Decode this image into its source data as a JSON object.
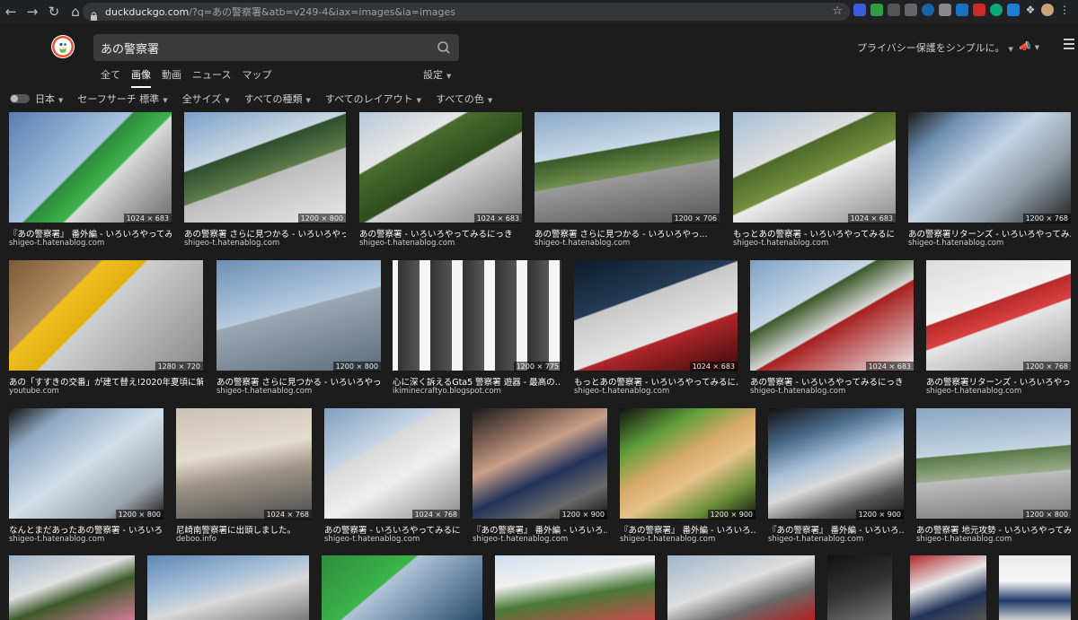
{
  "browser": {
    "url_host": "duckduckgo.com",
    "url_rest": "/?q=あの警察署&atb=v249-4&iax=images&ia=images"
  },
  "search": {
    "query": "あの警察署"
  },
  "tabs": [
    {
      "label": "全て",
      "active": false
    },
    {
      "label": "画像",
      "active": true
    },
    {
      "label": "動画",
      "active": false
    },
    {
      "label": "ニュース",
      "active": false
    },
    {
      "label": "マップ",
      "active": false
    }
  ],
  "settings_label": "設定",
  "privacy_label": "プライバシー保護をシンプルに。",
  "filters": {
    "region": "日本",
    "items": [
      "セーフサーチ 標準",
      "全サイズ",
      "すべての種類",
      "すべてのレイアウト",
      "すべての色"
    ]
  },
  "images": [
    {
      "dims": "1024 × 683",
      "title": "『あの警察署』 番外編 - いろいろやってみ...",
      "source": "shigeo-t.hatenablog.com"
    },
    {
      "dims": "1200 × 800",
      "title": "あの警察署 さらに見つかる - いろいろやっ...",
      "source": "shigeo-t.hatenablog.com"
    },
    {
      "dims": "1024 × 683",
      "title": "あの警察署 - いろいろやってみるにっき",
      "source": "shigeo-t.hatenablog.com"
    },
    {
      "dims": "1200 × 706",
      "title": "あの警察署 さらに見つかる - いろいろやっ...",
      "source": "shigeo-t.hatenablog.com"
    },
    {
      "dims": "1024 × 683",
      "title": "もっとあの警察署 - いろいろやってみるに...",
      "source": "shigeo-t.hatenablog.com"
    },
    {
      "dims": "1200 × 768",
      "title": "あの警察署リターンズ - いろいろやってみ...",
      "source": "shigeo-t.hatenablog.com"
    },
    {
      "dims": "1280 × 720",
      "title": "あの「すすきの交番」が建て替え!2020年夏頃に解...",
      "source": "youtube.com"
    },
    {
      "dims": "1200 × 800",
      "title": "あの警察署 さらに見つかる - いろいろやっ...",
      "source": "shigeo-t.hatenablog.com"
    },
    {
      "dims": "1200 × 775",
      "title": "心に深く訴えるGta5 警察署 遊器 - 最高の…",
      "source": "ikiminecraftyo.blogspot.com"
    },
    {
      "dims": "1024 × 683",
      "title": "もっとあの警察署 - いろいろやってみるに...",
      "source": "shigeo-t.hatenablog.com"
    },
    {
      "dims": "1024 × 683",
      "title": "あの警察署 - いろいろやってみるにっき",
      "source": "shigeo-t.hatenablog.com"
    },
    {
      "dims": "1200 × 768",
      "title": "あの警察署リターンズ - いろいろやっ...",
      "source": "shigeo-t.hatenablog.com"
    },
    {
      "dims": "1200 × 800",
      "title": "なんとまだあったあの警察署 - いろいろ...",
      "source": "shigeo-t.hatenablog.com"
    },
    {
      "dims": "1024 × 768",
      "title": "尼崎南警察署に出頭しました。",
      "source": "deboo.info"
    },
    {
      "dims": "1024 × 768",
      "title": "あの警察署 - いろいろやってみるに...",
      "source": "shigeo-t.hatenablog.com"
    },
    {
      "dims": "1200 × 900",
      "title": "『あの警察署』 番外編 - いろいろ...",
      "source": "shigeo-t.hatenablog.com"
    },
    {
      "dims": "1200 × 900",
      "title": "『あの警察署』 番外編 - いろいろ...",
      "source": "shigeo-t.hatenablog.com"
    },
    {
      "dims": "1200 × 900",
      "title": "『あの警察署』 番外編 - いろいろ...",
      "source": "shigeo-t.hatenablog.com"
    },
    {
      "dims": "1200 × 800",
      "title": "あの警察署 地元攻勢 - いろいろやってみ...",
      "source": "shigeo-t.hatenablog.com"
    },
    {
      "dims": "",
      "title": "",
      "source": ""
    },
    {
      "dims": "",
      "title": "",
      "source": ""
    },
    {
      "dims": "",
      "title": "",
      "source": ""
    },
    {
      "dims": "",
      "title": "",
      "source": ""
    },
    {
      "dims": "",
      "title": "",
      "source": ""
    },
    {
      "dims": "",
      "title": "",
      "source": ""
    },
    {
      "dims": "",
      "title": "",
      "source": ""
    },
    {
      "dims": "",
      "title": "",
      "source": ""
    }
  ]
}
